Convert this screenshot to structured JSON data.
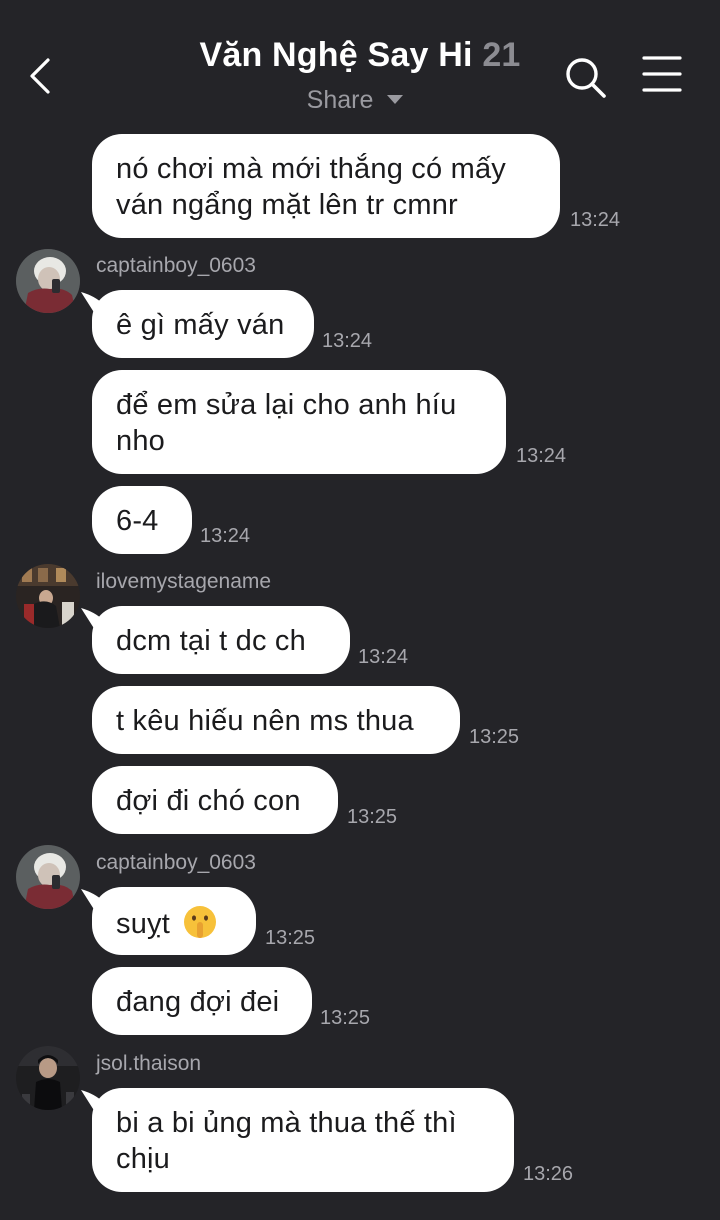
{
  "header": {
    "title": "Văn Nghệ Say Hi",
    "member_count": "21",
    "share_label": "Share"
  },
  "messages": [
    {
      "text_line1": "nó chơi mà mới thắng có mấy",
      "text_line2": "ván ngẩng mặt lên tr cmnr",
      "time": "13:24"
    },
    {
      "username": "captainboy_0603",
      "text": "ê gì mấy ván",
      "time": "13:24"
    },
    {
      "text_line1": "để em sửa lại cho anh híu",
      "text_line2": "nho",
      "time": "13:24"
    },
    {
      "text": "6-4",
      "time": "13:24"
    },
    {
      "username": "ilovemystagename",
      "text": "dcm tại t dc ch",
      "time": "13:24"
    },
    {
      "text": "t kêu hiếu nên ms thua",
      "time": "13:25"
    },
    {
      "text": "đợi đi chó con",
      "time": "13:25"
    },
    {
      "username": "captainboy_0603",
      "text": "suỵt",
      "emoji": "shushing-face",
      "time": "13:25"
    },
    {
      "text": "đang đợi đei",
      "time": "13:25"
    },
    {
      "username": "jsol.thaison",
      "text_line1": "bi a bi ủng mà thua thế thì",
      "text_line2": "chịu",
      "time": "13:26"
    }
  ]
}
